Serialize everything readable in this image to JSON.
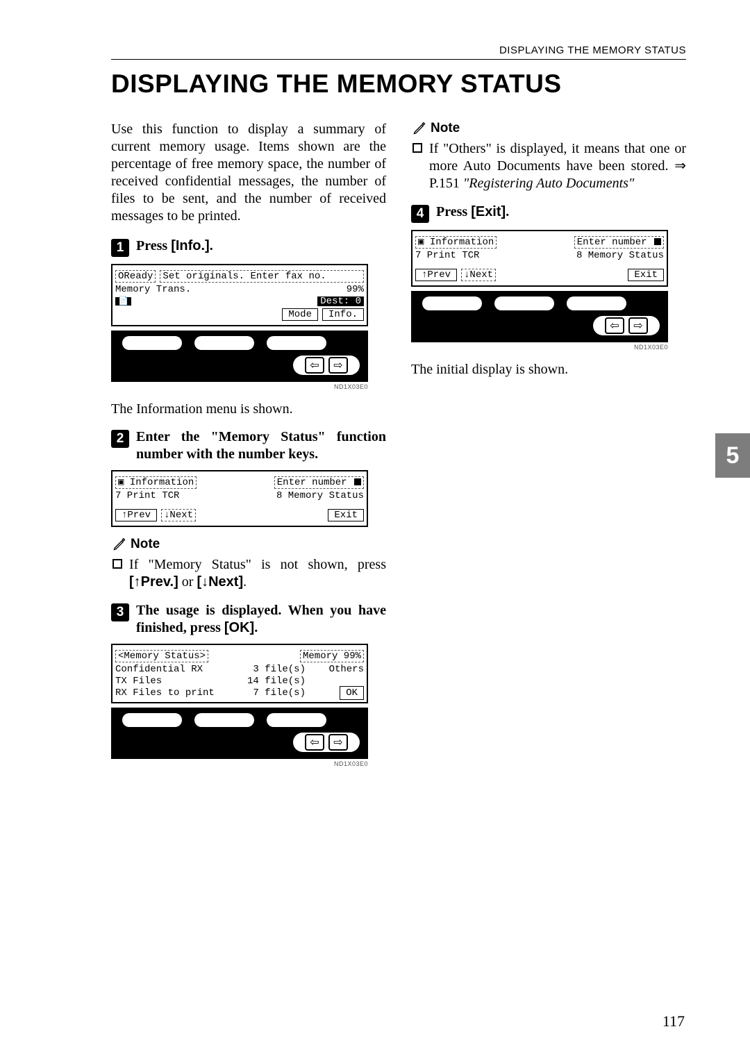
{
  "header": {
    "running_title": "DISPLAYING THE MEMORY STATUS"
  },
  "title": "DISPLAYING THE MEMORY STATUS",
  "intro": "Use this function to display a summary of current memory usage. Items shown are the percentage of free memory space, the number of received confidential messages, the number of files to be sent, and the number of received messages to be printed.",
  "steps": {
    "s1": {
      "num": "1",
      "prefix": "Press ",
      "key": "[Info.]",
      "suffix": "."
    },
    "s2": {
      "num": "2",
      "text": "Enter the \"Memory Status\" function number with the number keys."
    },
    "s3": {
      "num": "3",
      "prefix": "The usage is displayed. When you have finished, press ",
      "key": "[OK]",
      "suffix": "."
    },
    "s4": {
      "num": "4",
      "prefix": "Press ",
      "key": "[Exit]",
      "suffix": "."
    }
  },
  "lcd1": {
    "line1a": "OReady",
    "line1b": "Set originals. Enter fax no.",
    "line2a": "Memory Trans.",
    "line2b": "99%",
    "line3_dest": "Dest:  0",
    "btn_mode": "Mode",
    "btn_info": "Info."
  },
  "caption1": "The Information menu is shown.",
  "lcd2": {
    "hdr_left": "Information",
    "hdr_right": "Enter number",
    "line1a": "7 Print TCR",
    "line1b": "8 Memory Status",
    "btn_prev": "↑Prev",
    "btn_next": "↓Next",
    "btn_exit": "Exit"
  },
  "note_label": "Note",
  "note1": {
    "prefix": "If \"Memory Status\" is not shown, press ",
    "k1": "[↑Prev.]",
    "mid": " or ",
    "k2": "[↓Next]",
    "suffix": "."
  },
  "lcd3": {
    "hdr_left": "<Memory Status>",
    "hdr_right": "Memory 99%",
    "r1a": "Confidential RX",
    "r1b": "3 file(s)",
    "r1c": "Others",
    "r2a": "TX Files",
    "r2b": "14 file(s)",
    "r3a": "RX Files to print",
    "r3b": "7 file(s)",
    "btn_ok": "OK"
  },
  "note2": {
    "line1": "If \"Others\" is displayed, it means that one or more Auto Documents have been stored. ⇒ P.151 ",
    "ital": "\"Registering Auto Documents\""
  },
  "lcd4": {
    "hdr_left": "Information",
    "hdr_right": "Enter number",
    "line1a": "7 Print TCR",
    "line1b": "8 Memory Status",
    "btn_prev": "↑Prev",
    "btn_next": "↓Next",
    "btn_exit": "Exit"
  },
  "caption4": "The initial display is shown.",
  "figcode": "ND1X03E0",
  "side_tab": "5",
  "page_number": "117"
}
